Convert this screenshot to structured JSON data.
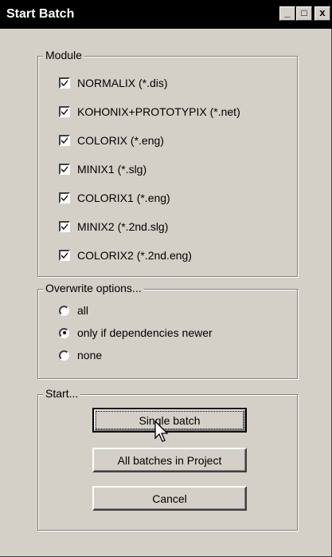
{
  "window": {
    "title": "Start Batch",
    "minimize": "_",
    "maximize": "□",
    "close": "x"
  },
  "module": {
    "label": "Module",
    "items": [
      {
        "label": "NORMALIX (*.dis)",
        "checked": true
      },
      {
        "label": "KOHONIX+PROTOTYPIX (*.net)",
        "checked": true
      },
      {
        "label": "COLORIX (*.eng)",
        "checked": true
      },
      {
        "label": "MINIX1 (*.slg)",
        "checked": true
      },
      {
        "label": "COLORIX1 (*.eng)",
        "checked": true
      },
      {
        "label": "MINIX2 (*.2nd.slg)",
        "checked": true
      },
      {
        "label": "COLORIX2 (*.2nd.eng)",
        "checked": true
      }
    ]
  },
  "overwrite": {
    "label": "Overwrite options...",
    "options": [
      {
        "label": "all",
        "selected": false
      },
      {
        "label": "only if dependencies newer",
        "selected": true
      },
      {
        "label": "none",
        "selected": false
      }
    ]
  },
  "start": {
    "label": "Start...",
    "single_batch": "Single batch",
    "all_batches": "All batches in Project",
    "cancel": "Cancel"
  }
}
